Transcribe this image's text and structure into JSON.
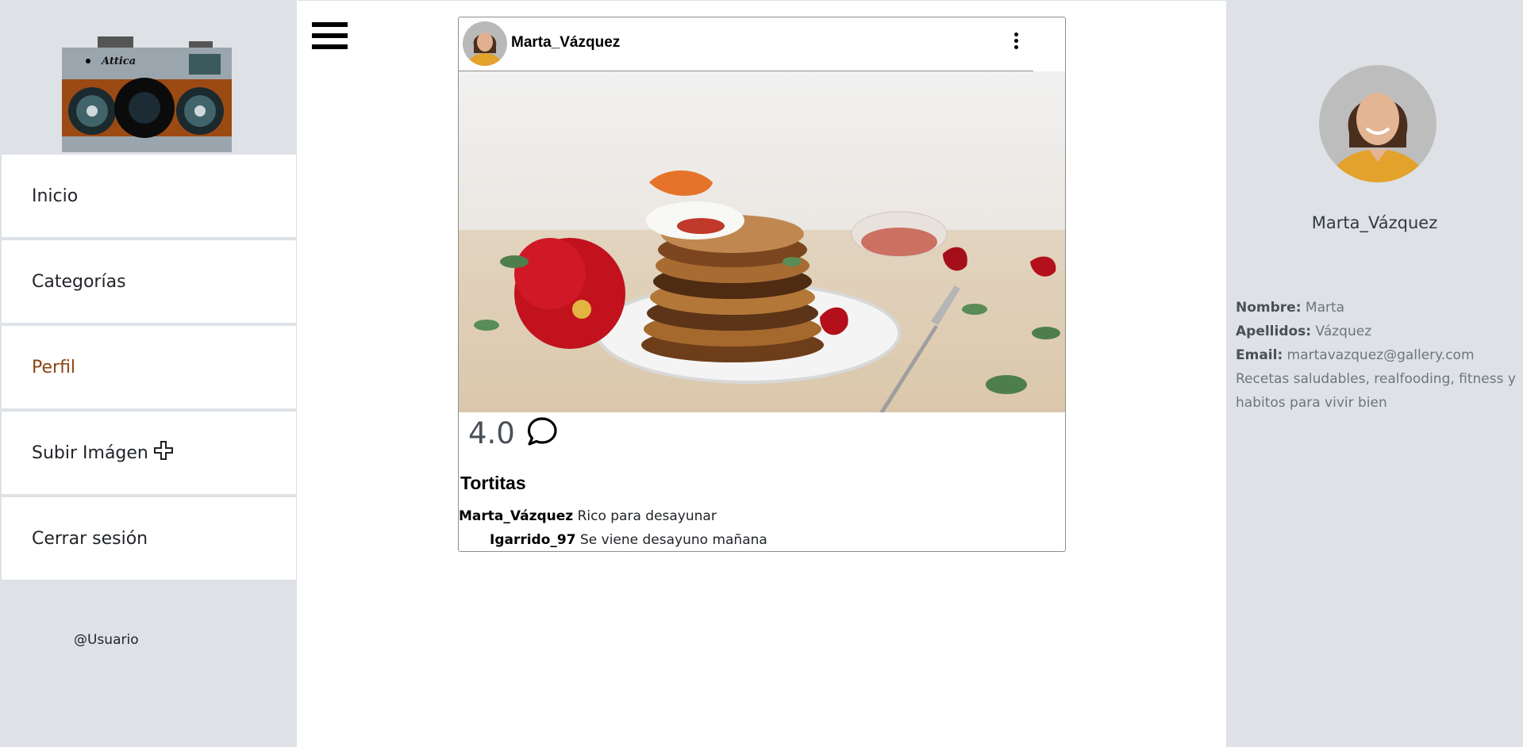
{
  "sidebar": {
    "logo_text": "Attica",
    "items": [
      {
        "label": "Inicio",
        "active": false
      },
      {
        "label": "Categorías",
        "active": false
      },
      {
        "label": "Perfil",
        "active": true
      },
      {
        "label": "Subir Imágen",
        "active": false,
        "icon": "plus-icon"
      },
      {
        "label": "Cerrar sesión",
        "active": false
      }
    ],
    "user_handle": "@Usuario"
  },
  "post": {
    "username": "Marta_Vázquez",
    "rating": "4.0",
    "title": "Tortitas",
    "comments": [
      {
        "user": "Marta_Vázquez",
        "text": "Rico para desayunar"
      },
      {
        "user": "Igarrido_97",
        "text": "Se viene desayuno mañana"
      }
    ]
  },
  "profile": {
    "name": "Marta_Vázquez",
    "nombre_label": "Nombre:",
    "nombre": "Marta",
    "apellidos_label": "Apellidos:",
    "apellidos": "Vázquez",
    "email_label": "Email:",
    "email": "martavazquez@gallery.com",
    "bio": "Recetas saludables, realfooding, fitness y habitos para vivir bien"
  },
  "colors": {
    "sidebar_bg": "#dee2e6",
    "active_nav": "#8b4513"
  }
}
